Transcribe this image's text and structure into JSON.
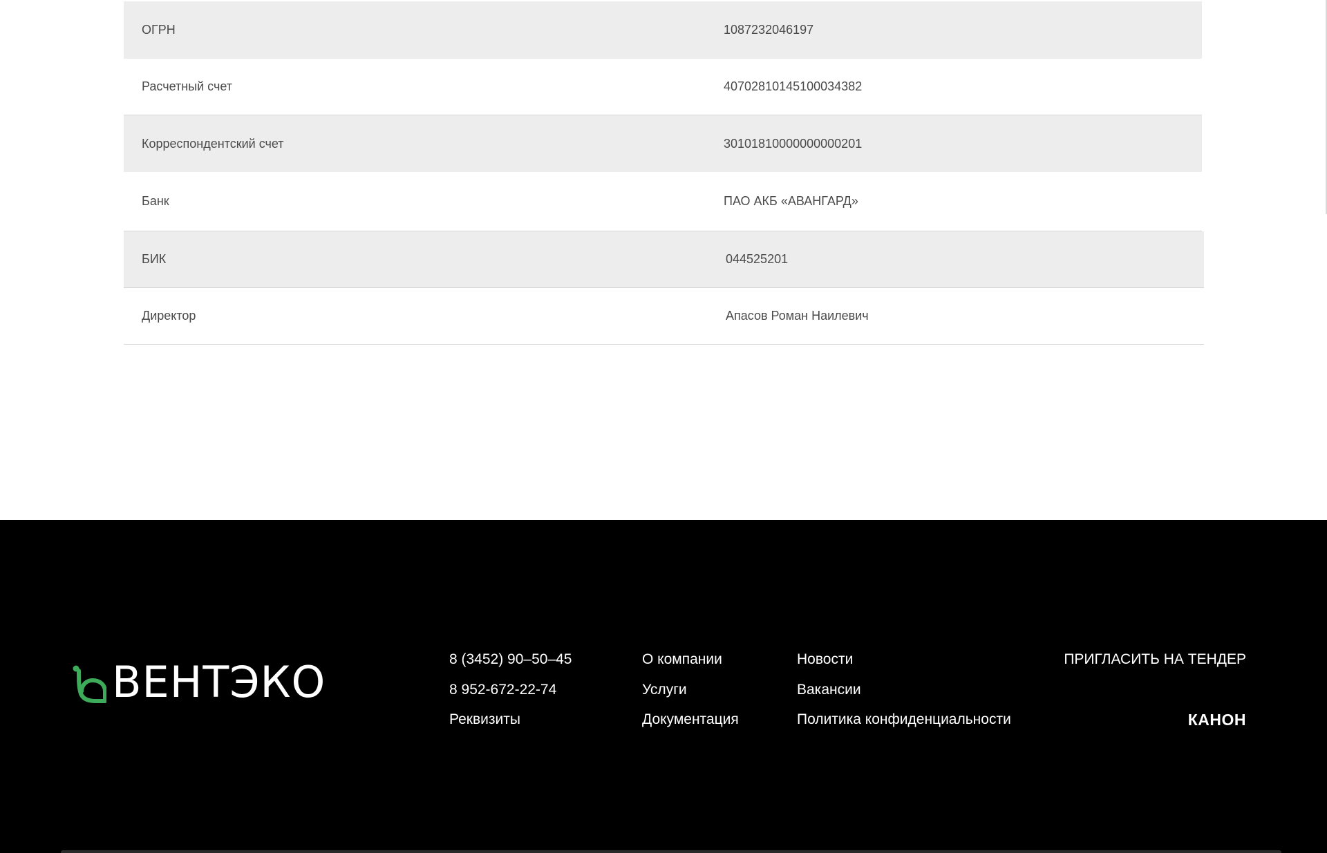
{
  "requisites": {
    "rows": [
      {
        "label": "ОГРН",
        "value": "1087232046197"
      },
      {
        "label": "Расчетный счет",
        "value": "40702810145100034382"
      },
      {
        "label": "Корреспондентский счет",
        "value": "30101810000000000201"
      },
      {
        "label": "Банк",
        "value": "ПАО АКБ «АВАНГАРД»"
      },
      {
        "label": "БИК",
        "value": "044525201"
      },
      {
        "label": "Директор",
        "value": "Апасов Роман Наилевич"
      }
    ]
  },
  "footer": {
    "logo_text": "ВЕНТЭКО",
    "contacts": {
      "phone_1": "8 (3452) 90–50–45",
      "phone_2": "8 952-672-22-74",
      "requisites": "Реквизиты"
    },
    "company_links": {
      "about": "О компании",
      "services": "Услуги",
      "documentation": "Документация"
    },
    "info_links": {
      "news": "Новости",
      "vacancies": "Вакансии",
      "privacy": "Политика конфиденциальности"
    },
    "tender_link": "ПРИГЛАСИТЬ НА ТЕНДЕР",
    "developer_mark": "КАНОН"
  },
  "colors": {
    "brand_green": "#3dab5a",
    "footer_bg": "#000000",
    "row_shade": "#ededed"
  }
}
